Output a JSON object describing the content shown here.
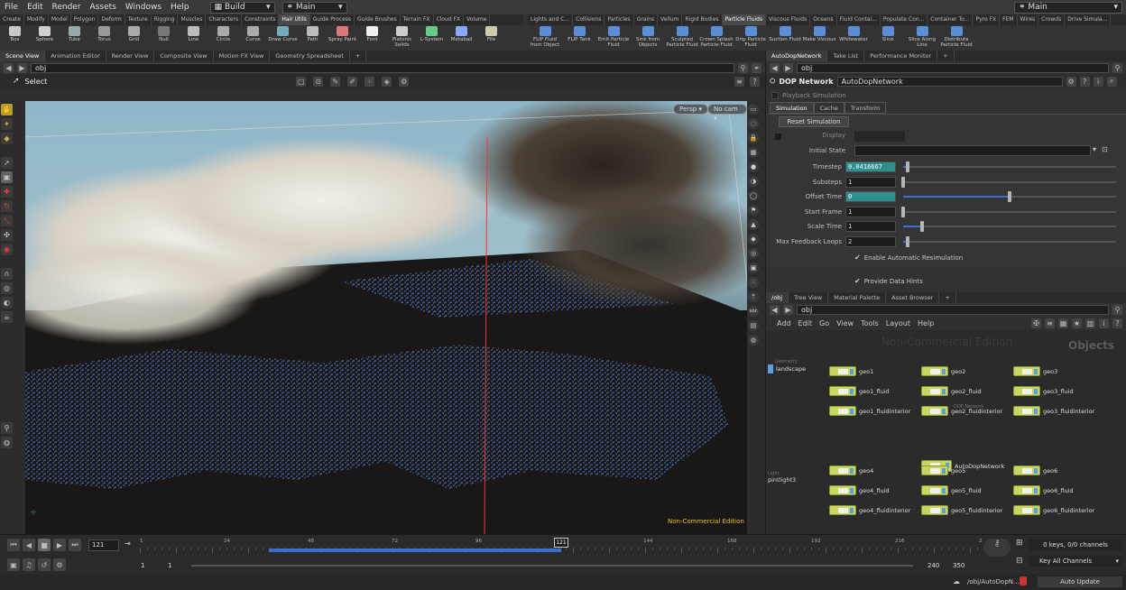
{
  "menu": [
    "File",
    "Edit",
    "Render",
    "Assets",
    "Windows",
    "Help"
  ],
  "desktop": "Build",
  "context": "Main",
  "right_context": "Main",
  "shelf_tabs_left": [
    "Create",
    "Modify",
    "Model",
    "Polygon",
    "Deform",
    "Texture",
    "Rigging",
    "Muscles",
    "Characters",
    "Constraints",
    "Hair Utils",
    "Guide Process",
    "Guide Brushes",
    "Terrain FX",
    "Cloud FX",
    "Volume"
  ],
  "shelf_tabs_right": [
    "Lights and C...",
    "Collisions",
    "Particles",
    "Grains",
    "Vellum",
    "Rigid Bodies",
    "Particle Fluids",
    "Viscous Fluids",
    "Oceans",
    "Fluid Contai...",
    "Populate Con...",
    "Container To...",
    "Pyro FX",
    "FEM",
    "Wires",
    "Crowds",
    "Drive Simula..."
  ],
  "shelf_tools_left": [
    "Box",
    "Sphere",
    "Tube",
    "Torus",
    "Grid",
    "Null",
    "Line",
    "Circle",
    "Curve",
    "Draw Curve",
    "Path",
    "Spray Paint",
    "Font",
    "Platonic Solids",
    "L-System",
    "Metaball",
    "File"
  ],
  "shelf_tools_right": [
    "FLIP Fluid from Object",
    "FLIP Tank",
    "Emit Particle Fluid",
    "Sink from Objects",
    "Sculpted Particle Fluid",
    "Crown Splash Particle Fluid",
    "Drip Particle Fluid",
    "Suction Fluid",
    "Make Viscous",
    "Whitewater",
    "Slice",
    "Slice Along Line",
    "Distribute Particle Fluid"
  ],
  "viewer_tabs": [
    "Scene View",
    "Animation Editor",
    "Render View",
    "Composite View",
    "Motion FX View",
    "Geometry Spreadsheet"
  ],
  "viewer_path": "obj",
  "select_label": "Select",
  "persp_label": "Persp",
  "cam_label": "No cam",
  "watermark": "Non-Commercial Edition",
  "param_tabs": [
    "AutoDopNetwork",
    "Take List",
    "Performance Monitor"
  ],
  "param_path": "obj",
  "dop_type": "DOP Network",
  "dop_name": "AutoDopNetwork",
  "playback_label": "Playback Simulation",
  "sub_tabs": [
    "Simulation",
    "Cache",
    "Transform"
  ],
  "reset_label": "Reset Simulation",
  "display_label": "Display",
  "initial_state_label": "Initial State",
  "parms": [
    {
      "label": "Timestep",
      "value": "0.0416667",
      "frac": 0.02
    },
    {
      "label": "Substeps",
      "value": "1",
      "frac": 0.0
    },
    {
      "label": "Offset Time",
      "value": "0",
      "frac": 0.5
    },
    {
      "label": "Start Frame",
      "value": "1",
      "frac": 0.0
    },
    {
      "label": "Scale Time",
      "value": "1",
      "frac": 0.09
    },
    {
      "label": "Max Feedback Loops",
      "value": "2",
      "frac": 0.02
    }
  ],
  "checks": [
    "Enable Automatic Resimulation",
    "Provide Data Hints"
  ],
  "net_tabs": [
    "/obj",
    "Tree View",
    "Material Palette",
    "Asset Browser"
  ],
  "net_path": "obj",
  "net_menu": [
    "Add",
    "Edit",
    "Go",
    "View",
    "Tools",
    "Layout",
    "Help"
  ],
  "net_watermark": "Non-Commercial Edition",
  "net_title": "Objects",
  "landscape_sub": "Geometry",
  "landscape": "landscape",
  "light_sub": "Light",
  "light": "pintlight3",
  "dop_sub": "DOP Network",
  "nodes_top": [
    "geo1",
    "geo2",
    "geo3",
    "geo1_fluid",
    "geo2_fluid",
    "geo3_fluid",
    "geo1_fluidinterior",
    "geo2_fluidinterior",
    "geo3_fluidinterior"
  ],
  "dop_node": "AutoDopNetwork",
  "nodes_bottom": [
    "geo4",
    "geo5",
    "geo6",
    "geo4_fluid",
    "geo5_fluid",
    "geo6_fluid",
    "geo4_fluidinterior",
    "geo5_fluidinterior",
    "geo6_fluidinterior"
  ],
  "frame": "121",
  "ticks": [
    "1",
    "24",
    "48",
    "72",
    "96",
    "121",
    "144",
    "168",
    "192",
    "216",
    "2"
  ],
  "playbar_start": "1",
  "playbar_start2": "1",
  "playbar_end": "240",
  "playbar_end2": "350",
  "keys_label": "0 keys, 0/0 channels",
  "key_all": "Key All Channels",
  "status_path": "/obj/AutoDopN...",
  "auto_update": "Auto Update",
  "cache_frac": 0.5,
  "colors": {
    "accent": "#3a6ed0",
    "node": "#c9d65f",
    "teal": "#2f8f8f"
  }
}
